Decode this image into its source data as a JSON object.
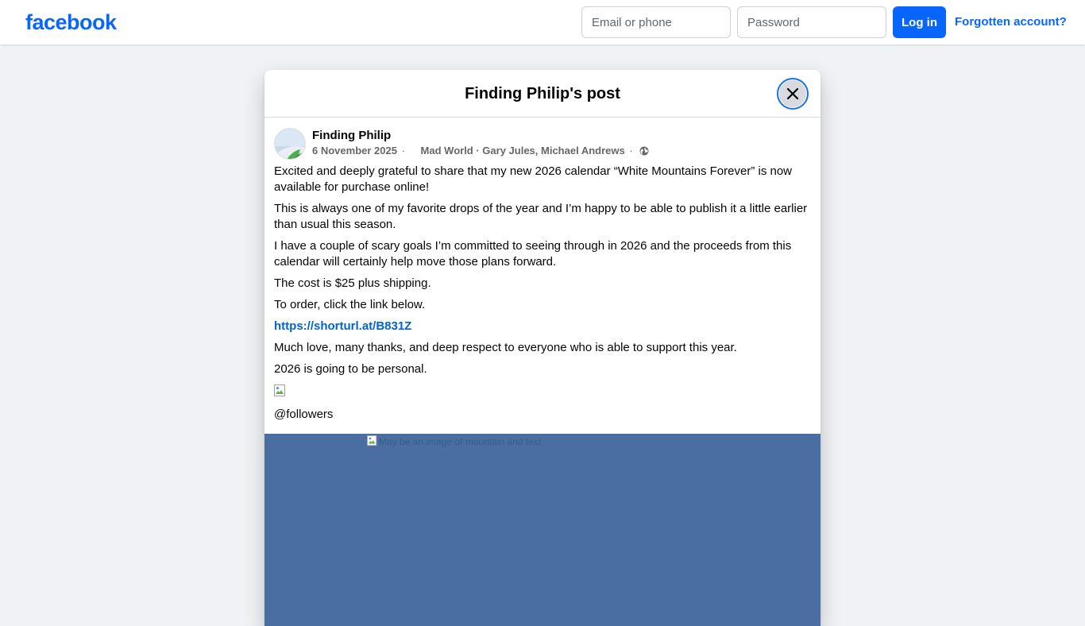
{
  "topbar": {
    "logo_text": "facebook",
    "email_placeholder": "Email or phone",
    "password_placeholder": "Password",
    "login_label": "Log in",
    "forgot_label": "Forgotten account?"
  },
  "modal": {
    "title": "Finding Philip's post",
    "close_icon": "close-icon"
  },
  "post": {
    "author": "Finding Philip",
    "date": "6 November 2025",
    "date_sep": "·",
    "music": "Mad World · Gary Jules, Michael Andrews",
    "music_sep": "·",
    "privacy_icon": "globe-icon",
    "paragraphs": [
      "Excited and deeply grateful to share that my new 2026 calendar “White Mountains Forever” is now available for purchase online!",
      "This is always one of my favorite drops of the year and I’m happy to be able to publish it a little earlier than usual this season.",
      "I have a couple of scary goals I’m committed to seeing through in 2026 and the proceeds from this calendar will certainly help move those plans forward.",
      "The cost is $25 plus shipping.",
      "To order, click the link below."
    ],
    "link": "https://shorturl.at/B831Z",
    "paragraphs_after": [
      "Much love, many thanks, and deep respect to everyone who is able to support this year.",
      "2026 is going to be personal."
    ],
    "followers_tag": "@followers",
    "image_alt": "May be an image of mountain and text",
    "colors": {
      "image_bg": "#4a6ea1",
      "link": "#0064d1",
      "brand": "#0866ff"
    }
  }
}
